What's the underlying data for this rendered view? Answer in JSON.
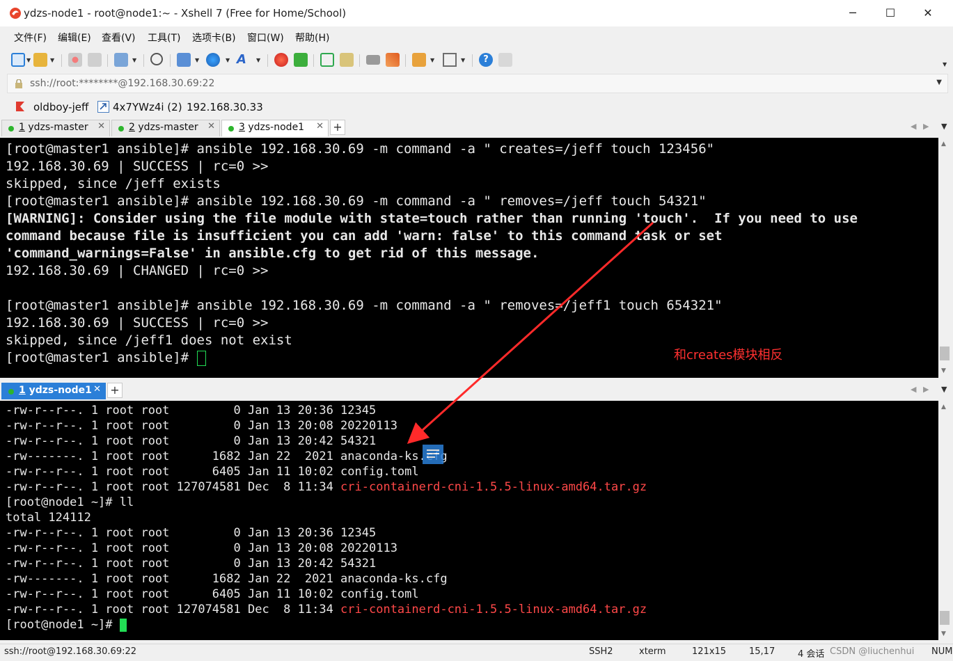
{
  "window": {
    "title": "ydzs-node1 - root@node1:~ - Xshell 7 (Free for Home/School)",
    "minimize": "─",
    "maximize": "☐",
    "close": "✕"
  },
  "menu": [
    "文件(F)",
    "编辑(E)",
    "查看(V)",
    "工具(T)",
    "选项卡(B)",
    "窗口(W)",
    "帮助(H)"
  ],
  "address": {
    "text": "ssh://root:********@192.168.30.69:22"
  },
  "links": [
    {
      "label": "oldboy-jeff"
    },
    {
      "label": "4x7YWz4i (2)"
    },
    {
      "label": "192.168.30.33"
    }
  ],
  "top_tabs": [
    {
      "num": "1",
      "label": " ydzs-master",
      "close": "✕"
    },
    {
      "num": "2",
      "label": " ydzs-master",
      "close": "✕"
    },
    {
      "num": "3",
      "label": " ydzs-node1",
      "close": "✕"
    }
  ],
  "plus": "+",
  "term1": {
    "lines": [
      "[root@master1 ansible]# ansible 192.168.30.69 -m command -a \" creates=/jeff touch 123456\"",
      "192.168.30.69 | SUCCESS | rc=0 >>",
      "skipped, since /jeff exists",
      "[root@master1 ansible]# ansible 192.168.30.69 -m command -a \" removes=/jeff touch 54321\"",
      "[WARNING]: Consider using the file module with state=touch rather than running 'touch'.  If you need to use",
      "command because file is insufficient you can add 'warn: false' to this command task or set",
      "'command_warnings=False' in ansible.cfg to get rid of this message.",
      "192.168.30.69 | CHANGED | rc=0 >>",
      "",
      "[root@master1 ansible]# ansible 192.168.30.69 -m command -a \" removes=/jeff1 touch 654321\"",
      "192.168.30.69 | SUCCESS | rc=0 >>",
      "skipped, since /jeff1 does not exist",
      "[root@master1 ansible]# "
    ],
    "annotation": "和creates模块相反"
  },
  "bottom_tab": {
    "num": "1",
    "label": " ydzs-node1",
    "close": "✕"
  },
  "term2": {
    "block1": [
      {
        "meta": "-rw-r--r--. 1 root root         0 Jan 13 20:36 ",
        "name": "12345",
        "red": false
      },
      {
        "meta": "-rw-r--r--. 1 root root         0 Jan 13 20:08 ",
        "name": "20220113",
        "red": false
      },
      {
        "meta": "-rw-r--r--. 1 root root         0 Jan 13 20:42 ",
        "name": "54321",
        "red": false
      },
      {
        "meta": "-rw-------. 1 root root      1682 Jan 22  2021 ",
        "name": "anaconda-ks.cfg",
        "red": false
      },
      {
        "meta": "-rw-r--r--. 1 root root      6405 Jan 11 10:02 ",
        "name": "config.toml",
        "red": false
      },
      {
        "meta": "-rw-r--r--. 1 root root 127074581 Dec  8 11:34 ",
        "name": "cri-containerd-cni-1.5.5-linux-amd64.tar.gz",
        "red": true
      }
    ],
    "prompt_ll": "[root@node1 ~]# ll",
    "total": "total 124112",
    "block2": [
      {
        "meta": "-rw-r--r--. 1 root root         0 Jan 13 20:36 ",
        "name": "12345",
        "red": false
      },
      {
        "meta": "-rw-r--r--. 1 root root         0 Jan 13 20:08 ",
        "name": "20220113",
        "red": false
      },
      {
        "meta": "-rw-r--r--. 1 root root         0 Jan 13 20:42 ",
        "name": "54321",
        "red": false
      },
      {
        "meta": "-rw-------. 1 root root      1682 Jan 22  2021 ",
        "name": "anaconda-ks.cfg",
        "red": false
      },
      {
        "meta": "-rw-r--r--. 1 root root      6405 Jan 11 10:02 ",
        "name": "config.toml",
        "red": false
      },
      {
        "meta": "-rw-r--r--. 1 root root 127074581 Dec  8 11:34 ",
        "name": "cri-containerd-cni-1.5.5-linux-amd64.tar.gz",
        "red": true
      }
    ],
    "prompt_end": "[root@node1 ~]# "
  },
  "status": {
    "address": "ssh://root@192.168.30.69:22",
    "protocol": "SSH2",
    "term": "xterm",
    "size": "121x15",
    "cursor": "15,17",
    "sessions": "4 会话",
    "watermark": "CSDN @liuchenhui",
    "numlock": "NUM"
  },
  "colors": {
    "terminal_bg": "#000000",
    "success_green": "#1f8f1f",
    "changed_yellow": "#c6b21b",
    "warning_magenta": "#ff4cff",
    "archive_red": "#ff4848",
    "annotation_red": "#ff3030",
    "cursor_green": "#22dd55"
  },
  "icons": [
    "app-icon",
    "new-session-icon",
    "open-folder-icon",
    "link-icon",
    "properties-icon",
    "find-icon",
    "transfer-icon",
    "globe-icon",
    "font-icon",
    "xshell-icon",
    "xftp-icon",
    "fullscreen-icon",
    "lock-icon",
    "keyboard-icon",
    "script-icon",
    "compose-icon",
    "layout-icon",
    "help-icon",
    "chat-icon"
  ]
}
